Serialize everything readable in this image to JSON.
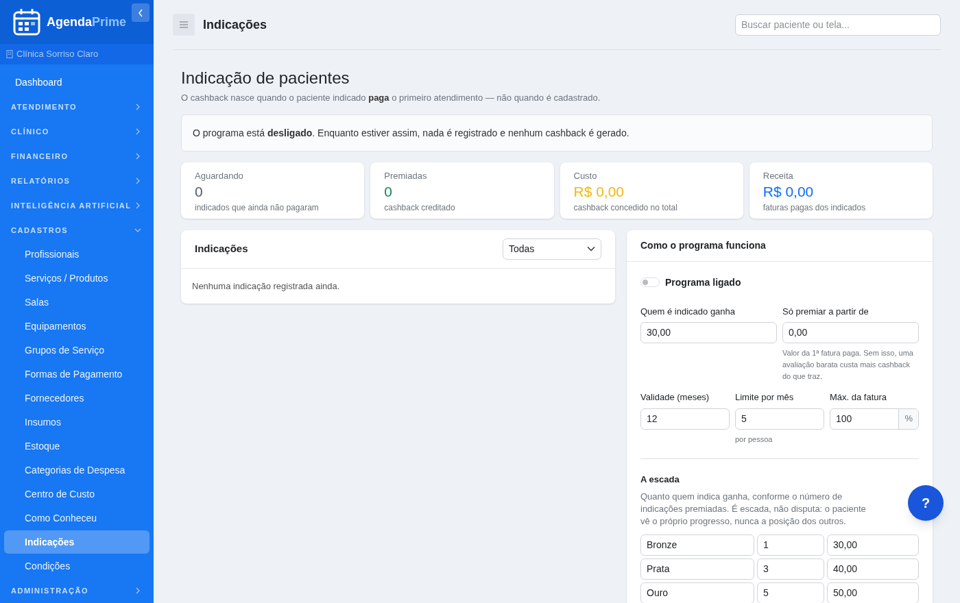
{
  "brand": {
    "part1": "Agenda",
    "part2": "Prime"
  },
  "clinic": "Clínica Sorriso Claro",
  "sidebar": {
    "items": [
      {
        "kind": "link",
        "label": "Dashboard",
        "selected": false
      },
      {
        "kind": "section",
        "label": "ATENDIMENTO",
        "expanded": false
      },
      {
        "kind": "section",
        "label": "CLÍNICO",
        "expanded": false
      },
      {
        "kind": "section",
        "label": "FINANCEIRO",
        "expanded": false
      },
      {
        "kind": "section",
        "label": "RELATÓRIOS",
        "expanded": false
      },
      {
        "kind": "section",
        "label": "INTELIGÊNCIA ARTIFICIAL",
        "expanded": false
      },
      {
        "kind": "section",
        "label": "CADASTROS",
        "expanded": true,
        "children": [
          {
            "label": "Profissionais",
            "selected": false
          },
          {
            "label": "Serviços / Produtos",
            "selected": false
          },
          {
            "label": "Salas",
            "selected": false
          },
          {
            "label": "Equipamentos",
            "selected": false
          },
          {
            "label": "Grupos de Serviço",
            "selected": false
          },
          {
            "label": "Formas de Pagamento",
            "selected": false
          },
          {
            "label": "Fornecedores",
            "selected": false
          },
          {
            "label": "Insumos",
            "selected": false
          },
          {
            "label": "Estoque",
            "selected": false
          },
          {
            "label": "Categorias de Despesa",
            "selected": false
          },
          {
            "label": "Centro de Custo",
            "selected": false
          },
          {
            "label": "Como Conheceu",
            "selected": false
          },
          {
            "label": "Indicações",
            "selected": true
          },
          {
            "label": "Condições",
            "selected": false
          }
        ]
      },
      {
        "kind": "section",
        "label": "ADMINISTRAÇÃO",
        "expanded": false
      }
    ]
  },
  "topbar": {
    "title": "Indicações",
    "search_placeholder": "Buscar paciente ou tela..."
  },
  "page": {
    "title": "Indicação de pacientes",
    "subtitle": "O cashback nasce quando o paciente indicado **paga** o primeiro atendimento — não quando é cadastrado."
  },
  "notice": "O programa está **desligado**. Enquanto estiver assim, nada é registrado e nenhum cashback é gerado.",
  "stats": [
    {
      "label": "Aguardando",
      "value": "0",
      "note": "indicados que ainda não pagaram",
      "color": "#555b66"
    },
    {
      "label": "Premiadas",
      "value": "0",
      "note": "cashback creditado",
      "color": "#198754"
    },
    {
      "label": "Custo",
      "value": "R$ 0,00",
      "note": "cashback concedido no total",
      "color": "#f2b90c"
    },
    {
      "label": "Receita",
      "value": "R$ 0,00",
      "note": "faturas pagas dos indicados",
      "color": "#0d6efd"
    }
  ],
  "referrals": {
    "title": "Indicações",
    "filter": "Todas",
    "empty": "Nenhuma indicação registrada ainda."
  },
  "program": {
    "title": "Como o programa funciona",
    "switch_label": "Programa ligado",
    "on": false,
    "fields1": [
      {
        "label": "Quem é indicado ganha",
        "value": "30,00"
      },
      {
        "label": "Só premiar a partir de",
        "value": "0,00",
        "help": "Valor da 1ª fatura paga. Sem isso, uma avaliação barata custa mais cashback do que traz."
      }
    ],
    "fields2": [
      {
        "label": "Validade (meses)",
        "value": "12"
      },
      {
        "label": "Limite por mês",
        "value": "5",
        "help": "por pessoa"
      },
      {
        "label": "Máx. da fatura",
        "value": "100",
        "suffix": "%"
      }
    ],
    "ladder_title": "A escada",
    "ladder_text": "Quanto quem indica ganha, conforme o número de indicações premiadas. É escada, não disputa: o paciente vê o próprio progresso, nunca a posição dos outros.",
    "tiers": [
      {
        "name": "Bronze",
        "count": "1",
        "amount": "30,00"
      },
      {
        "name": "Prata",
        "count": "3",
        "amount": "40,00"
      },
      {
        "name": "Ouro",
        "count": "5",
        "amount": "50,00"
      }
    ]
  },
  "help_button": "?"
}
